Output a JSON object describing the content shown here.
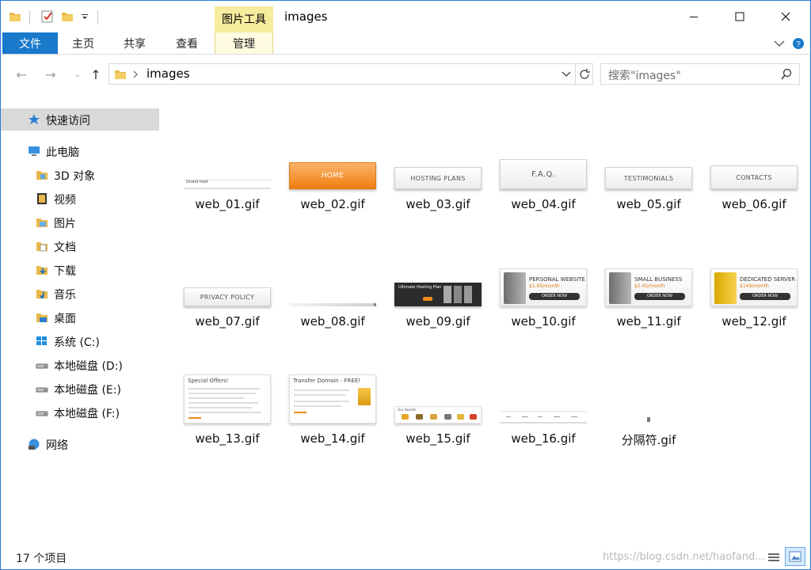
{
  "window": {
    "title": "images",
    "context_tab_group": "图片工具"
  },
  "ribbon": {
    "tabs": [
      {
        "label": "文件"
      },
      {
        "label": "主页"
      },
      {
        "label": "共享"
      },
      {
        "label": "查看"
      },
      {
        "label": "管理"
      }
    ]
  },
  "address": {
    "path": "images",
    "search_placeholder": "搜索\"images\""
  },
  "nav": {
    "items": [
      {
        "label": "快速访问",
        "icon": "star-icon"
      },
      {
        "label": "此电脑",
        "icon": "computer-icon"
      },
      {
        "label": "3D 对象",
        "icon": "3d-objects-icon"
      },
      {
        "label": "视频",
        "icon": "video-icon"
      },
      {
        "label": "图片",
        "icon": "pictures-icon"
      },
      {
        "label": "文档",
        "icon": "documents-icon"
      },
      {
        "label": "下载",
        "icon": "downloads-icon"
      },
      {
        "label": "音乐",
        "icon": "music-icon"
      },
      {
        "label": "桌面",
        "icon": "desktop-icon"
      },
      {
        "label": "系统 (C:)",
        "icon": "windows-drive-icon"
      },
      {
        "label": "本地磁盘 (D:)",
        "icon": "drive-icon"
      },
      {
        "label": "本地磁盘 (E:)",
        "icon": "drive-icon"
      },
      {
        "label": "本地磁盘 (F:)",
        "icon": "drive-icon"
      },
      {
        "label": "网络",
        "icon": "network-icon"
      }
    ]
  },
  "files": [
    {
      "name": "web_01.gif",
      "thumb": "Grand host"
    },
    {
      "name": "web_02.gif",
      "thumb": "HOME"
    },
    {
      "name": "web_03.gif",
      "thumb": "HOSTING PLANS"
    },
    {
      "name": "web_04.gif",
      "thumb": "F.A.Q."
    },
    {
      "name": "web_05.gif",
      "thumb": "TESTIMONIALS"
    },
    {
      "name": "web_06.gif",
      "thumb": "CONTACTS"
    },
    {
      "name": "web_07.gif",
      "thumb": "PRIVACY POLICY"
    },
    {
      "name": "web_08.gif",
      "thumb": ""
    },
    {
      "name": "web_09.gif",
      "thumb": "Ultimate Hosting Plan"
    },
    {
      "name": "web_10.gif",
      "thumb": "PERSONAL WEBSITE",
      "price": "$1.95/month",
      "order": "ORDER NOW"
    },
    {
      "name": "web_11.gif",
      "thumb": "SMALL BUSINESS",
      "price": "$2.45/month",
      "order": "ORDER NOW"
    },
    {
      "name": "web_12.gif",
      "thumb": "DEDICATED SERVER",
      "price": "$149/month",
      "order": "ORDER NOW"
    },
    {
      "name": "web_13.gif",
      "thumb": "Special Offers!"
    },
    {
      "name": "web_14.gif",
      "thumb": "Transfer Domain - FREE!"
    },
    {
      "name": "web_15.gif",
      "thumb": "Our Awards"
    },
    {
      "name": "web_16.gif",
      "thumb": ""
    },
    {
      "name": "分隔符.gif",
      "thumb": ""
    }
  ],
  "status": {
    "count": "17 个项目",
    "watermark": "https://blog.csdn.net/haofand..."
  },
  "colors": {
    "accent": "#1979ca",
    "context_tab": "#f6ec9e",
    "selection": "#d9d9d9"
  }
}
